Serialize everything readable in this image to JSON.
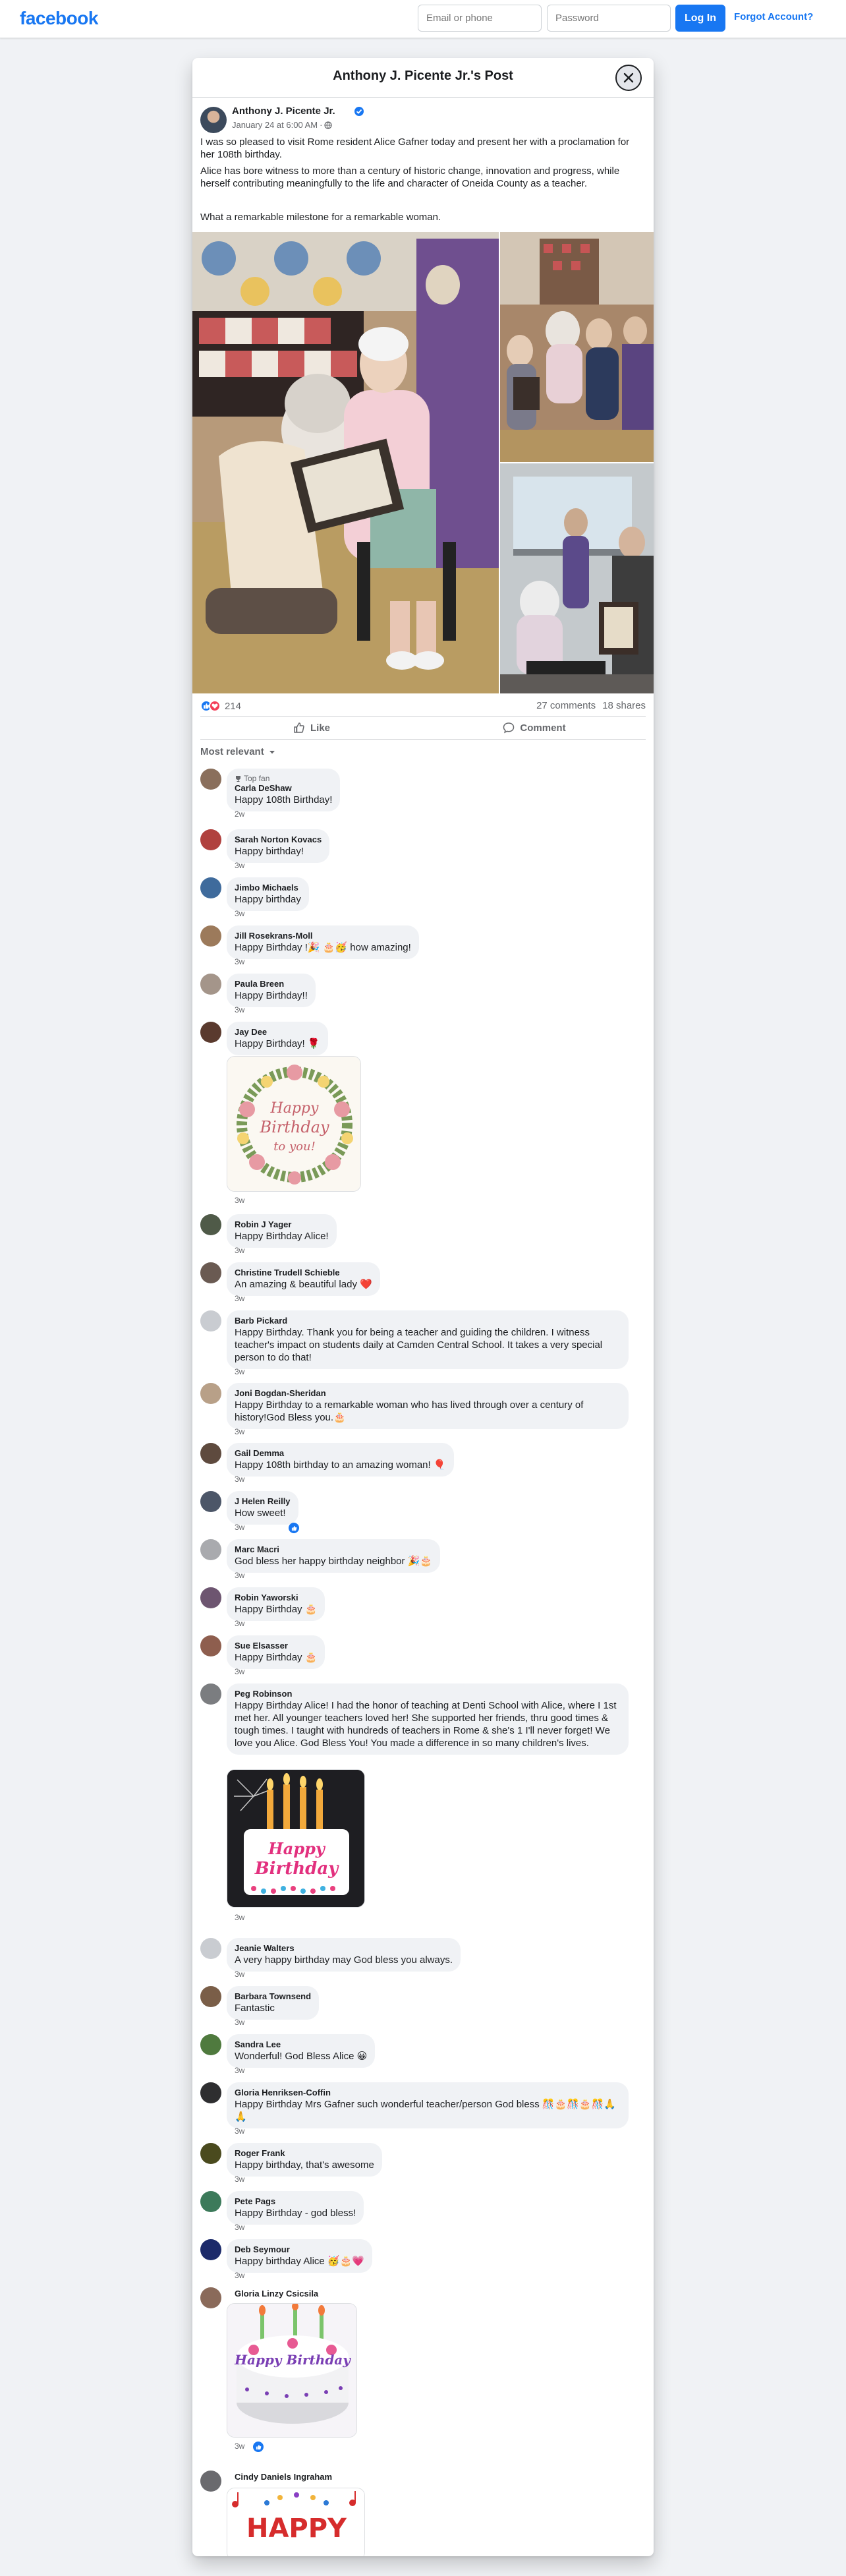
{
  "topbar": {
    "logo": "facebook",
    "email_placeholder": "Email or phone",
    "password_placeholder": "Password",
    "login_label": "Log In",
    "forgot_label": "Forgot Account?"
  },
  "modal": {
    "title": "Anthony J. Picente Jr.'s Post"
  },
  "post": {
    "author": "Anthony J. Picente Jr.",
    "timestamp": "January 24 at 6:00 AM",
    "paragraphs": [
      "I was so pleased to visit Rome resident Alice Gafner today and present her with a proclamation for her 108th birthday.",
      "Alice has bore witness to more than a century of historic change, innovation and progress, while herself contributing meaningfully to the life and character of Oneida County as a teacher.",
      "What a remarkable milestone for a remarkable woman."
    ],
    "reaction_count": "214",
    "comment_count": "27 comments",
    "share_count": "18 shares",
    "like_label": "Like",
    "comment_label": "Comment",
    "sort_label": "Most relevant"
  },
  "comments": [
    {
      "name": "Carla DeShaw",
      "badge": "Top fan",
      "text": "Happy 108th Birthday!",
      "time": "2w"
    },
    {
      "name": "Sarah Norton Kovacs",
      "text": "Happy birthday!",
      "time": "3w"
    },
    {
      "name": "Jimbo Michaels",
      "text": "Happy birthday",
      "time": "3w"
    },
    {
      "name": "Jill Rosekrans-Moll",
      "text": "Happy Birthday !🎉 🎂🥳 how amazing!",
      "time": "3w"
    },
    {
      "name": "Paula Breen",
      "text": "Happy Birthday!!",
      "time": "3w"
    },
    {
      "name": "Jay Dee",
      "text": "Happy Birthday! 🌹",
      "time": "3w"
    },
    {
      "name": "Robin J Yager",
      "text": "Happy Birthday Alice!",
      "time": "3w"
    },
    {
      "name": "Christine Trudell Schieble",
      "text": "An amazing & beautiful lady ❤️",
      "time": "3w"
    },
    {
      "name": "Barb Pickard",
      "text": "Happy Birthday. Thank you for being a teacher and guiding the children. I witness teacher's impact on students daily at Camden Central School. It takes a very special person to do that!",
      "time": "3w"
    },
    {
      "name": "Joni Bogdan-Sheridan",
      "text": "Happy Birthday to a remarkable woman who has lived through over a century of history!God Bless you.🎂",
      "time": "3w"
    },
    {
      "name": "Gail Demma",
      "text": "Happy 108th birthday to an amazing woman! 🎈",
      "time": "3w"
    },
    {
      "name": "J Helen Reilly",
      "text": "How sweet!",
      "time": "3w"
    },
    {
      "name": "Marc Macri",
      "text": "God bless her happy birthday neighbor 🎉🎂",
      "time": "3w"
    },
    {
      "name": "Robin Yaworski",
      "text": "Happy Birthday 🎂",
      "time": "3w"
    },
    {
      "name": "Sue Elsasser",
      "text": "Happy Birthday 🎂",
      "time": "3w"
    },
    {
      "name": "Peg Robinson",
      "text": "Happy Birthday Alice! I had the honor of teaching at Denti School with Alice, where I 1st met her. All younger teachers loved her! She supported her friends, thru good times & tough times. I taught with hundreds of teachers in Rome & she's 1 I'll never forget! We love you Alice. God Bless You! You made a difference in so many children's lives.",
      "time": "3w"
    },
    {
      "name": "Jeanie Walters",
      "text": "A very happy birthday may God bless you always.",
      "time": "3w"
    },
    {
      "name": "Barbara Townsend",
      "text": "Fantastic",
      "time": "3w"
    },
    {
      "name": "Sandra Lee",
      "text": "Wonderful! God Bless Alice 😀",
      "time": "3w"
    },
    {
      "name": "Gloria Henriksen-Coffin",
      "text": "Happy Birthday Mrs Gafner such wonderful teacher/person God bless 🎊🎂🎊🎂🎊🙏🙏",
      "time": "3w"
    },
    {
      "name": "Roger Frank",
      "text": "Happy birthday, that's awesome",
      "time": "3w"
    },
    {
      "name": "Pete Pags",
      "text": "Happy Birthday - god bless!",
      "time": "3w"
    },
    {
      "name": "Deb Seymour",
      "text": "Happy birthday Alice 🥳🎂💗",
      "time": "3w"
    },
    {
      "name": "Gloria Linzy Csicsila",
      "text": "",
      "time": "3w"
    },
    {
      "name": "Cindy Daniels Ingraham",
      "text": "",
      "time": ""
    }
  ],
  "images": {
    "wreath_happy": "Happy",
    "wreath_birthday": "Birthday",
    "wreath_toyou": "to you!",
    "cake_happy": "Happy",
    "cake_birthday": "Birthday",
    "cake2_text": "Happy Birthday",
    "music_text": "HAPPY"
  },
  "colors": {
    "brand": "#1877f2",
    "like_blue": "#1877f2",
    "love_red": "#f33e58"
  }
}
